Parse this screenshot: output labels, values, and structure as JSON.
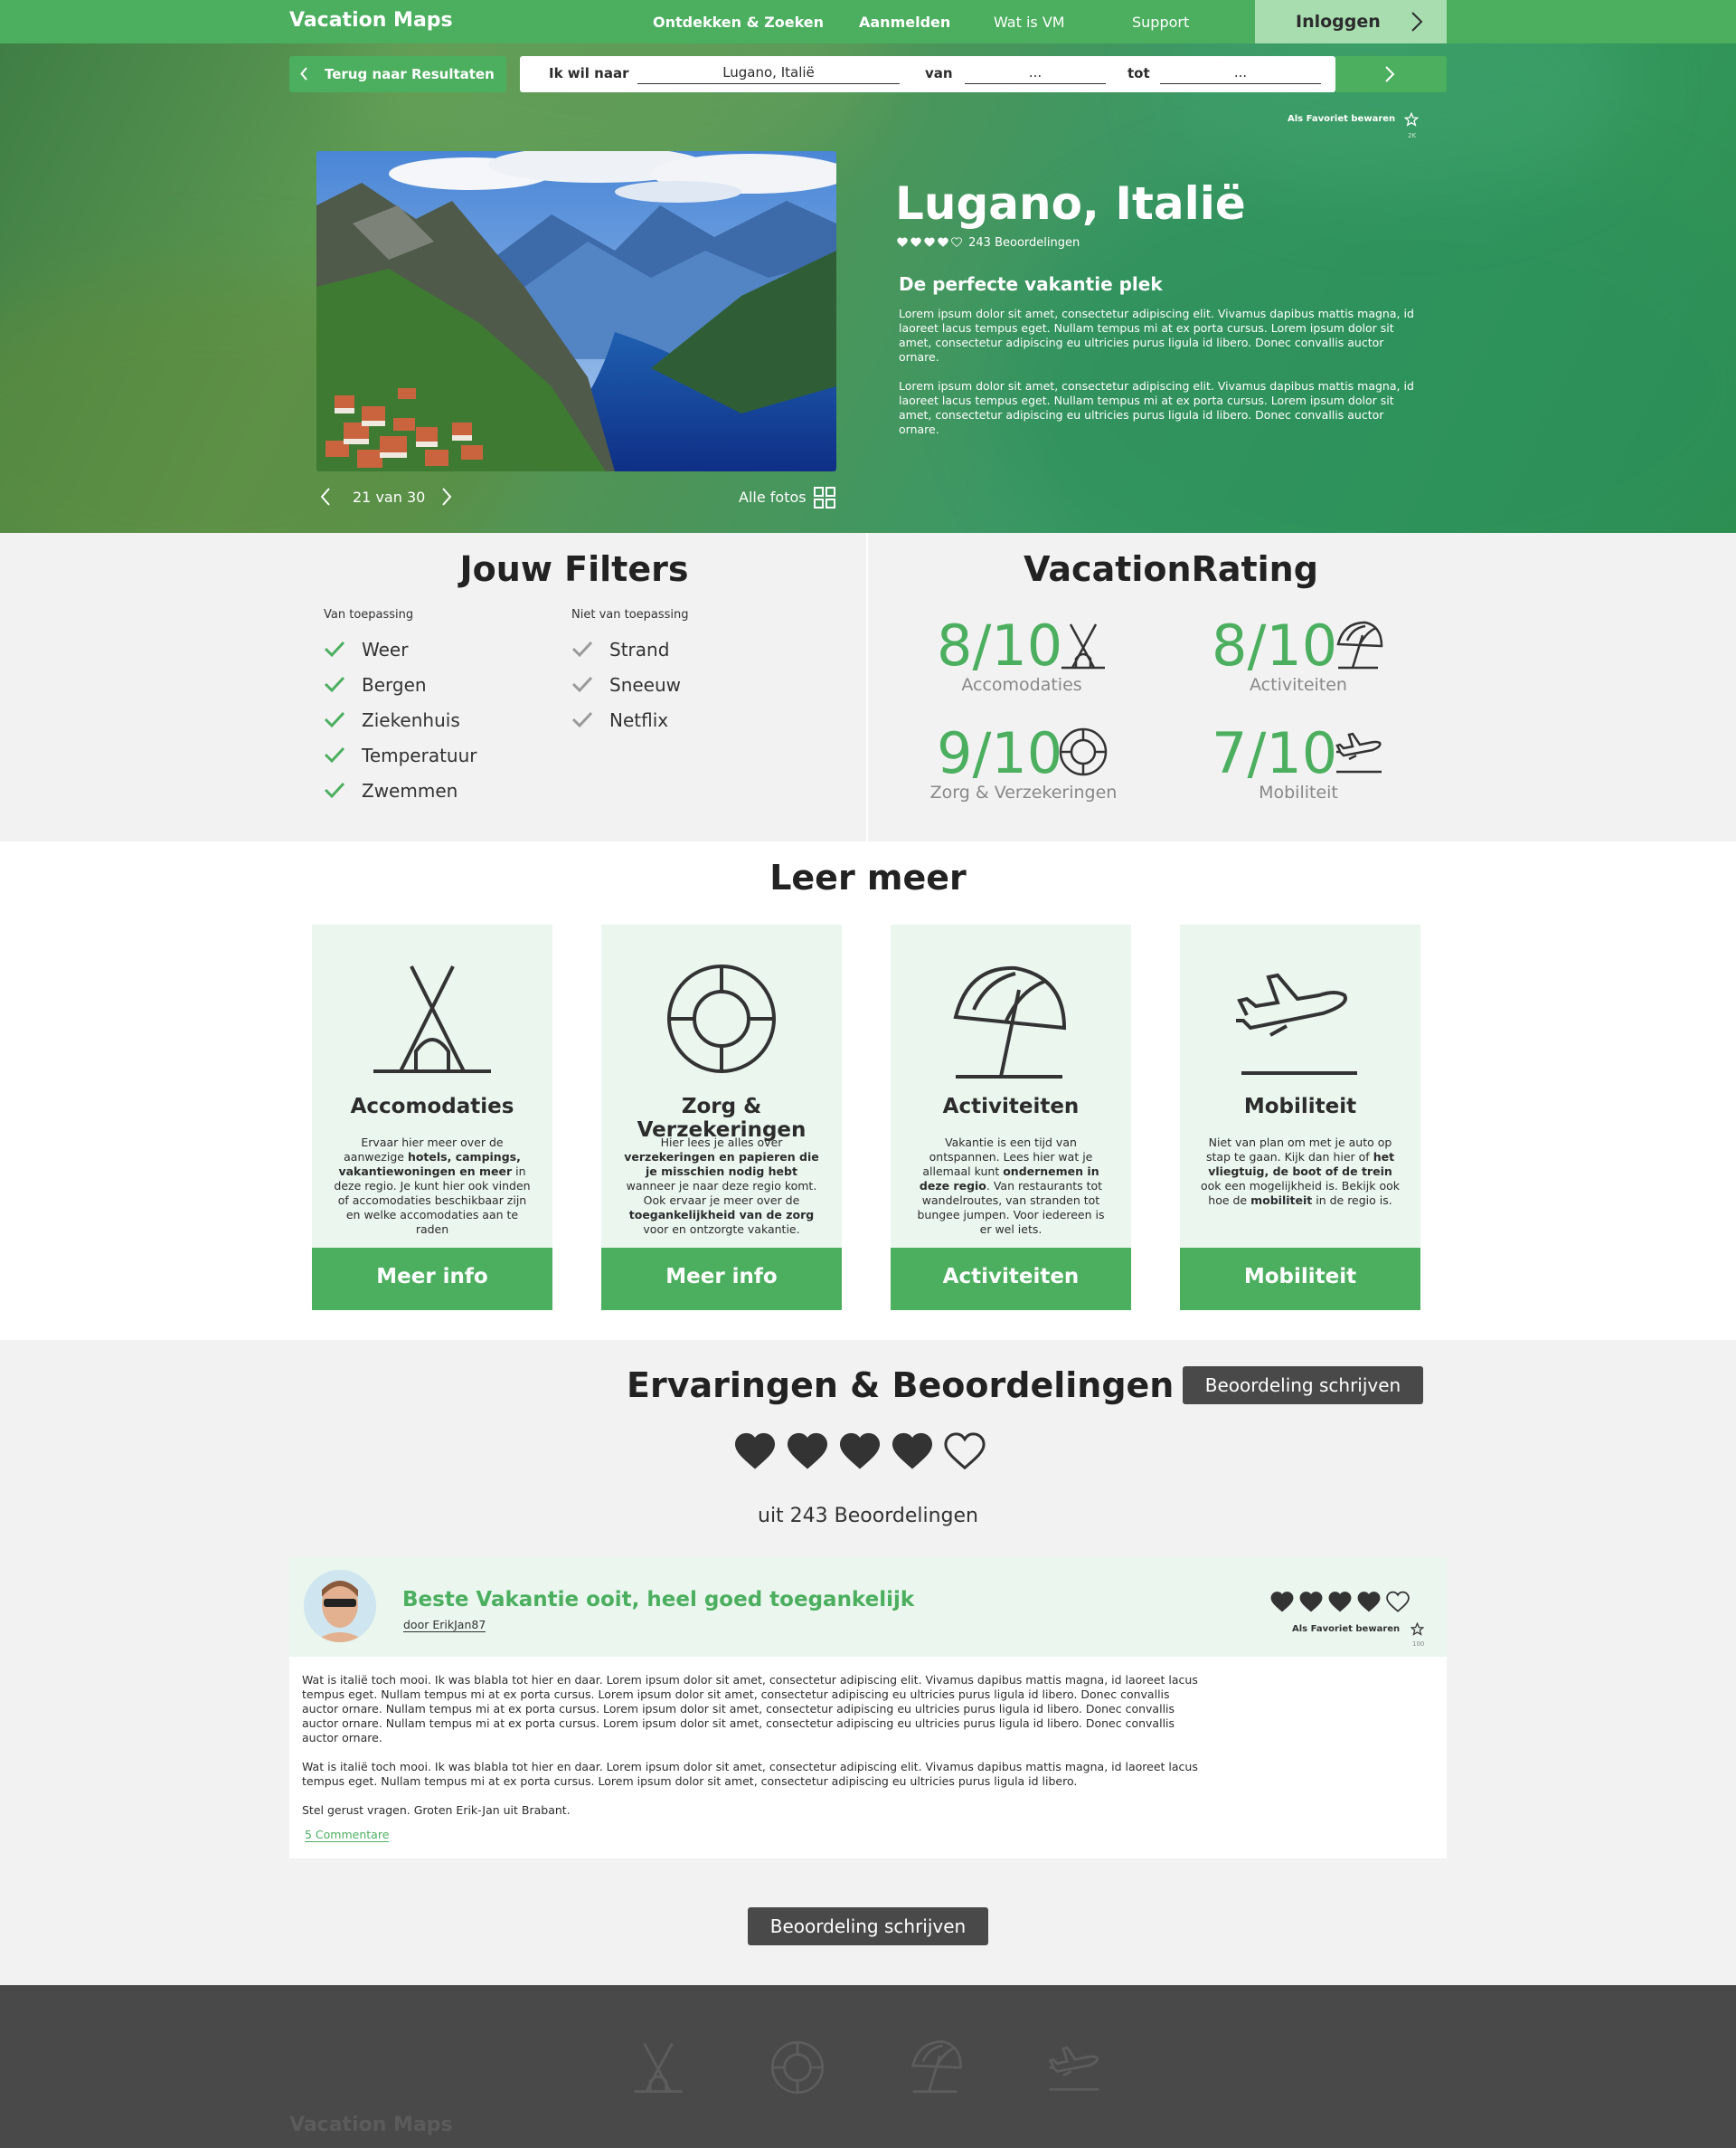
{
  "nav": {
    "logo": "Vacation Maps",
    "links": [
      "Ontdekken & Zoeken",
      "Aanmelden",
      "Wat is VM",
      "Support"
    ],
    "login": "Inloggen"
  },
  "search": {
    "back": "Terug naar Resultaten",
    "label_dest": "Ik wil naar",
    "dest_value": "Lugano, Italië",
    "label_from": "van",
    "from_value": "...",
    "label_to": "tot",
    "to_value": "..."
  },
  "hero": {
    "favorite": "Als Favoriet bewaren",
    "favorite_count": "2K",
    "title": "Lugano, Italië",
    "rating_hearts": 4,
    "rating_max": 5,
    "reviews": "243 Beoordelingen",
    "subtitle": "De perfecte vakantie plek",
    "paragraph1": "Lorem ipsum dolor sit amet, consectetur adipiscing elit. Vivamus dapibus mattis magna, id laoreet lacus tempus eget. Nullam tempus mi at ex porta cursus. Lorem ipsum dolor sit amet, consectetur adipiscing eu ultricies purus ligula id libero. Donec convallis auctor ornare.",
    "paragraph2": "Lorem ipsum dolor sit amet, consectetur adipiscing elit. Vivamus dapibus mattis magna, id laoreet lacus tempus eget. Nullam tempus mi at ex porta cursus. Lorem ipsum dolor sit amet, consectetur adipiscing eu ultricies purus ligula id libero. Donec convallis auctor ornare.",
    "photo_counter": "21 van 30",
    "all_photos": "Alle fotos"
  },
  "filters": {
    "title": "Jouw Filters",
    "applicable_head": "Van toepassing",
    "applicable": [
      "Weer",
      "Bergen",
      "Ziekenhuis",
      "Temperatuur",
      "Zwemmen"
    ],
    "not_applicable_head": "Niet van toepassing",
    "not_applicable": [
      "Strand",
      "Sneeuw",
      "Netflix"
    ]
  },
  "rating": {
    "title": "VacationRating",
    "items": [
      {
        "score": "8/10",
        "label": "Accomodaties",
        "icon": "tent-icon"
      },
      {
        "score": "8/10",
        "label": "Activiteiten",
        "icon": "umbrella-icon"
      },
      {
        "score": "9/10",
        "label": "Zorg & Verzekeringen",
        "icon": "lifebuoy-icon"
      },
      {
        "score": "7/10",
        "label": "Mobiliteit",
        "icon": "airplane-icon"
      }
    ]
  },
  "learn": {
    "title": "Leer meer",
    "cards": [
      {
        "title": "Accomodaties",
        "button": "Meer info",
        "icon": "tent-icon"
      },
      {
        "title": "Zorg & Verzekeringen",
        "button": "Meer info",
        "icon": "lifebuoy-icon"
      },
      {
        "title": "Activiteiten",
        "button": "Activiteiten",
        "icon": "umbrella-icon"
      },
      {
        "title": "Mobiliteit",
        "button": "Mobiliteit",
        "icon": "airplane-icon"
      }
    ],
    "card_text": [
      [
        "Ervaar hier meer over de aanwezige ",
        "hotels, campings, vakantiewoningen en meer",
        " in deze regio. Je kunt hier ook vinden of accomodaties beschikbaar zijn en welke accomodaties aan te raden"
      ],
      [
        "Hier lees je alles over ",
        "verzekeringen en papieren die je misschien nodig hebt",
        " wanneer je naar deze regio komt. Ook ervaar je meer over de ",
        "toegankelijkheid van de zorg",
        " voor en ontzorgte vakantie."
      ],
      [
        "Vakantie is een tijd van ontspannen. Lees hier wat je allemaal kunt ",
        "ondernemen in deze regio",
        ". Van restaurants tot wandelroutes, van stranden tot bungee jumpen. Voor iedereen is er wel iets."
      ],
      [
        "Niet van plan om met je auto op stap te gaan. Kijk dan hier of ",
        "het vliegtuig, de boot of de trein",
        " ook een mogelijkheid is. Bekijk ook hoe de ",
        "mobiliteit",
        " in de regio is."
      ]
    ]
  },
  "reviews": {
    "title": "Ervaringen & Beoordelingen",
    "write_button": "Beoordeling schrijven",
    "hearts": 4,
    "hearts_max": 5,
    "count_text": "uit 243 Beoordelingen",
    "review": {
      "title": "Beste Vakantie ooit, heel goed toegankelijk",
      "author": "door ErikJan87",
      "hearts": 4,
      "favorite": "Als Favoriet bewaren",
      "favorite_count": "100",
      "paragraph1": "Wat is italië toch mooi. Ik was blabla tot hier en daar. Lorem ipsum dolor sit amet, consectetur adipiscing elit. Vivamus dapibus mattis magna, id laoreet lacus tempus eget. Nullam tempus mi at ex porta cursus. Lorem ipsum dolor sit amet, consectetur adipiscing eu ultricies purus ligula id libero. Donec convallis auctor ornare. Nullam tempus mi at ex porta cursus. Lorem ipsum dolor sit amet, consectetur adipiscing eu ultricies purus ligula id libero. Donec convallis auctor ornare. Nullam tempus mi at ex porta cursus. Lorem ipsum dolor sit amet, consectetur adipiscing eu ultricies purus ligula id libero. Donec convallis auctor ornare.",
      "paragraph2": "Wat is italië toch mooi. Ik was blabla tot hier en daar. Lorem ipsum dolor sit amet, consectetur adipiscing elit. Vivamus dapibus mattis magna, id laoreet lacus tempus eget. Nullam tempus mi at ex porta cursus. Lorem ipsum dolor sit amet, consectetur adipiscing eu ultricies purus ligula id libero.",
      "signoff": "Stel gerust vragen. Groten Erik-Jan uit Brabant.",
      "comments": "5 Commentare"
    }
  },
  "footer": {
    "logo": "Vacation Maps"
  },
  "colors": {
    "accent": "#4caf5f",
    "dark": "#4a4949",
    "panel": "#f2f2f2",
    "card": "#eaf6ee"
  }
}
